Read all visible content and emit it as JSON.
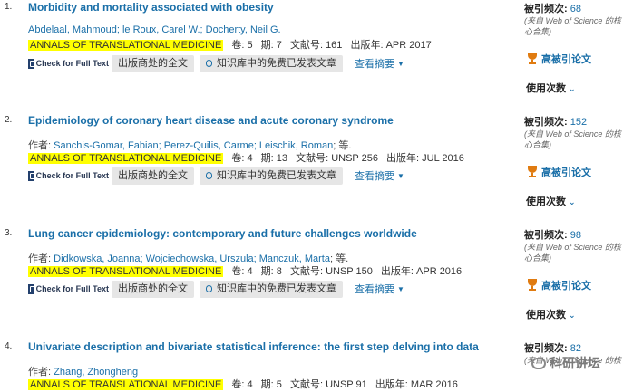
{
  "records": [
    {
      "num": "1.",
      "title": "Morbidity and mortality associated with obesity",
      "authors_prefix": "",
      "authors": "Abdelaal, Mahmoud; le Roux, Carel W.; Docherty, Neil G.",
      "authors_suffix": "",
      "journal": "ANNALS OF TRANSLATIONAL MEDICINE",
      "volume": "卷: 5",
      "issue": "期: 7",
      "article": "文献号: 161",
      "year": "出版年: APR 2017",
      "cited_label": "被引频次:",
      "cited_count": "68",
      "cited_sub": "(来自 Web of Science 的核心合集)"
    },
    {
      "num": "2.",
      "title": "Epidemiology of coronary heart disease and acute coronary syndrome",
      "authors_prefix": "作者: ",
      "authors": "Sanchis-Gomar, Fabian; Perez-Quilis, Carme; Leischik, Roman",
      "authors_suffix": "; 等.",
      "journal": "ANNALS OF TRANSLATIONAL MEDICINE",
      "volume": "卷: 4",
      "issue": "期: 13",
      "article": "文献号: UNSP 256",
      "year": "出版年: JUL 2016",
      "cited_label": "被引频次:",
      "cited_count": "152",
      "cited_sub": "(来自 Web of Science 的核心合集)"
    },
    {
      "num": "3.",
      "title": "Lung cancer epidemiology: contemporary and future challenges worldwide",
      "authors_prefix": "作者: ",
      "authors": "Didkowska, Joanna; Wojciechowska, Urszula; Manczuk, Marta",
      "authors_suffix": "; 等.",
      "journal": "ANNALS OF TRANSLATIONAL MEDICINE",
      "volume": "卷: 4",
      "issue": "期: 8",
      "article": "文献号: UNSP 150",
      "year": "出版年: APR 2016",
      "cited_label": "被引频次:",
      "cited_count": "98",
      "cited_sub": "(来自 Web of Science 的核心合集)"
    },
    {
      "num": "4.",
      "title": "Univariate description and bivariate statistical inference: the first step delving into data",
      "authors_prefix": "作者: ",
      "authors": "Zhang, Zhongheng",
      "authors_suffix": "",
      "journal": "ANNALS OF TRANSLATIONAL MEDICINE",
      "volume": "卷: 4",
      "issue": "期: 5",
      "article": "文献号: UNSP 91",
      "year": "出版年: MAR 2016",
      "cited_label": "被引频次:",
      "cited_count": "82",
      "cited_sub": "(来自 Web of Science 的核"
    }
  ],
  "actions": {
    "check_full_text": "Check for Full Text",
    "publisher_full_text": "出版商处的全文",
    "free_published": "知识库中的免费已发表文章",
    "view_abstract": "查看摘要"
  },
  "highly_cited_label": "高被引论文",
  "usage_label": "使用次数",
  "watermark": "科研讲坛",
  "colors": {
    "link": "#1a6fa8",
    "journal_highlight": "#ffff00",
    "trophy": "#e07b10"
  }
}
